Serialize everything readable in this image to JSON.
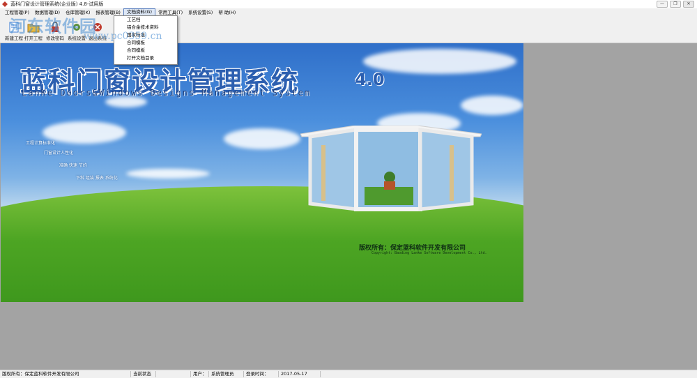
{
  "window": {
    "title": "蓝科门窗设计管理系统(企业版) 4.8-试用版",
    "min_glyph": "—",
    "max_glyph": "❐",
    "close_glyph": "✕"
  },
  "menu": [
    {
      "label": "工程管理(P)"
    },
    {
      "label": "数据管理(D)"
    },
    {
      "label": "仓库管理(K)"
    },
    {
      "label": "报表管理(B)"
    },
    {
      "label": "文档资料(G)"
    },
    {
      "label": "常用工具(T)"
    },
    {
      "label": "系统设置(S)"
    },
    {
      "label": "帮 助(H)"
    }
  ],
  "dropdown": {
    "items": [
      {
        "label": "工艺档"
      },
      {
        "label": "铝合金技术资料"
      },
      {
        "label": "国家标准"
      },
      {
        "label": "合同模板"
      },
      {
        "label": "合同模板"
      },
      {
        "label": "打开文档目录"
      }
    ]
  },
  "toolbar": {
    "buttons": [
      {
        "label": "新建工程",
        "icon": "new-project-icon",
        "color": "#3a7bd5"
      },
      {
        "label": "打开工程",
        "icon": "open-project-icon",
        "color": "#d8a531"
      },
      {
        "label": "修改密码",
        "icon": "password-icon",
        "color": "#c0392b"
      },
      {
        "label": "系统设置",
        "icon": "settings-icon",
        "color": "#5a8f3c"
      },
      {
        "label": "退出系统",
        "icon": "exit-icon",
        "color": "#c0392b"
      }
    ]
  },
  "watermark": {
    "main": "河东软件园",
    "sub": "www.pc0359.cn"
  },
  "splash": {
    "title": "蓝科门窗设计管理系统",
    "version": "4.0",
    "subtitle": "LanKe Doors&Windows Designs Management System",
    "features": [
      "工程计算标准化",
      "门窗设计人性化",
      "准确 快速 节约",
      "下料 组装 报表 系统化"
    ],
    "copyright": "版权所有：保定蓝科软件开发有限公司",
    "copyright_en": "Copyright: Baoding Lanke Software Development Co., Ltd."
  },
  "statusbar": {
    "copyright": "版权所有：保定蓝科软件开发有限公司",
    "state_label": "当前状态",
    "state_value": "",
    "user_label": "用户：",
    "user_value": "系统管理员",
    "login_label": "登录时间：",
    "login_value": "2017-05-17"
  },
  "colors": {
    "accent": "#2c5fb0",
    "menu_highlight": "#dce6f5"
  }
}
